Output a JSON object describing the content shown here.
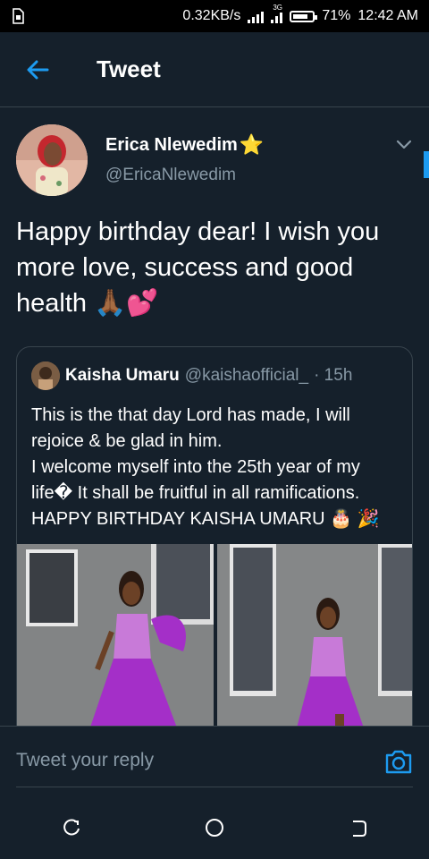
{
  "status_bar": {
    "speed": "0.32KB/s",
    "network": "3G",
    "battery": "71%",
    "time": "12:42 AM"
  },
  "header": {
    "title": "Tweet"
  },
  "tweet": {
    "author_name": "Erica Nlewedim",
    "verified_emoji": "⭐",
    "handle": "@EricaNlewedim",
    "text": "Happy birthday dear! I wish you more love, success and good health 🙏🏾💕"
  },
  "quoted_tweet": {
    "author_name": "Kaisha Umaru",
    "handle": "@kaishaofficial_",
    "time": "· 15h",
    "lines": [
      "This is the that day Lord has made, I will rejoice & be glad in him.",
      "I welcome myself into the 25th year of my life� It shall be fruitful in all ramifications.",
      "HAPPY BIRTHDAY KAISHA UMARU 🎂 🎉"
    ]
  },
  "reply": {
    "placeholder": "Tweet your reply"
  },
  "colors": {
    "background": "#15202b",
    "accent": "#1d9bf0",
    "secondary_text": "#8899a6",
    "border": "#38444d",
    "dress": "#a42fc8"
  },
  "icons": [
    "sim-icon",
    "signal-icon",
    "battery-icon",
    "back-arrow-icon",
    "chevron-down-icon",
    "camera-icon",
    "recents-icon",
    "home-icon",
    "back-icon"
  ]
}
